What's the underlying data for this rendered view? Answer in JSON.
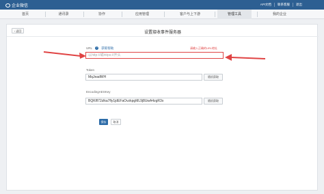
{
  "app": {
    "brand": "企业微信"
  },
  "topbar": {
    "links": [
      "API文档",
      "联系客服",
      "退出"
    ]
  },
  "nav": {
    "tabs": [
      "首页",
      "通讯录",
      "协作",
      "应用管理",
      "客户与上下游",
      "管理工具",
      "我的企业"
    ],
    "active_index": 5
  },
  "page": {
    "back_label": "返回",
    "title": "设置接收事件服务器"
  },
  "form": {
    "url": {
      "label": "URL",
      "help_link": "获取帮助",
      "placeholder": "以http://或https://开头",
      "value": "",
      "error_hint": "请输入正确的URL地址"
    },
    "token": {
      "label": "Token",
      "value": "MqJeadWH",
      "random_label": "随机获取"
    },
    "aeskey": {
      "label": "EncodingAESKey",
      "value": "BQKlfl72zlka7fly1jdEFaOvzkpgML9j8UwA4zgR3x",
      "random_label": "随机获取"
    },
    "save_label": "保存",
    "cancel_label": "取消"
  },
  "colors": {
    "topbar": "#2d5f92",
    "accent": "#2d6ca8",
    "error": "#e04343"
  }
}
